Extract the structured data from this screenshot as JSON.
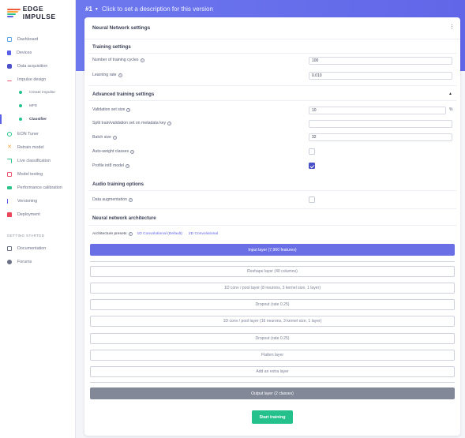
{
  "brand": {
    "name": "EDGE IMPULSE",
    "colors": [
      "#ef5a3a",
      "#ffa63c",
      "#2ec28b",
      "#5b61e6"
    ]
  },
  "sidebar": {
    "items": [
      {
        "label": "Dashboard",
        "icon": "monitor-icon",
        "color": "#5ea8e8"
      },
      {
        "label": "Devices",
        "icon": "device-icon",
        "color": "#5b61e6"
      },
      {
        "label": "Data acquisition",
        "icon": "database-icon",
        "color": "#4a50c7"
      },
      {
        "label": "Impulse design",
        "icon": "pulse-icon",
        "color": "#e85a72"
      }
    ],
    "sub_items": [
      {
        "label": "Create impulse"
      },
      {
        "label": "MFE"
      },
      {
        "label": "Classifier"
      }
    ],
    "items_after": [
      {
        "label": "EON Tuner",
        "icon": "eon-icon",
        "color": "#2ec28b"
      },
      {
        "label": "Retrain model",
        "icon": "retrain-icon",
        "color": "#f4a53a"
      },
      {
        "label": "Live classification",
        "icon": "live-icon",
        "color": "#2ec28b"
      },
      {
        "label": "Model testing",
        "icon": "testing-icon",
        "color": "#e85a72"
      },
      {
        "label": "Performance calibration",
        "icon": "calibration-icon",
        "color": "#2ec28b"
      },
      {
        "label": "Versioning",
        "icon": "versioning-icon",
        "color": "#5b61e6"
      },
      {
        "label": "Deployment",
        "icon": "deployment-icon",
        "color": "#e84a5a"
      }
    ],
    "section_label": "GETTING STARTED",
    "getting_started": [
      {
        "label": "Documentation",
        "icon": "documentation-icon",
        "color": "#6b7187"
      },
      {
        "label": "Forums",
        "icon": "forums-icon",
        "color": "#6b7187"
      }
    ]
  },
  "header": {
    "version": "#1",
    "description_placeholder": "Click to set a description for this version"
  },
  "card": {
    "title": "Neural Network settings",
    "training_settings": {
      "title": "Training settings",
      "cycles_label": "Number of training cycles",
      "cycles_value": "100",
      "lr_label": "Learning rate",
      "lr_value": "0.010"
    },
    "advanced": {
      "title": "Advanced training settings",
      "val_label": "Validation set size",
      "val_value": "10",
      "val_unit": "%",
      "split_label": "Split train/validation set on metadata key",
      "split_value": "",
      "batch_label": "Batch size",
      "batch_value": "32",
      "autoweight_label": "Auto-weight classes",
      "autoweight_checked": false,
      "profile_label": "Profile int8 model",
      "profile_checked": true
    },
    "audio": {
      "title": "Audio training options",
      "augmentation_label": "Data augmentation",
      "augmentation_checked": false
    },
    "architecture": {
      "title": "Neural network architecture",
      "presets_label": "Architecture presets",
      "preset_1": "1D Convolutional (Default)",
      "preset_2": "2D Convolutional",
      "input_layer": "Input layer (7,960 features)",
      "layers": [
        "Reshape layer (40 columns)",
        "1D conv / pool layer (8 neurons, 3 kernel size, 1 layer)",
        "Dropout (rate 0.25)",
        "1D conv / pool layer (16 neurons, 3 kernel size, 1 layer)",
        "Dropout (rate 0.25)",
        "Flatten layer"
      ],
      "add_layer": "Add an extra layer",
      "output_layer": "Output layer (2 classes)"
    },
    "start_button": "Start training"
  }
}
